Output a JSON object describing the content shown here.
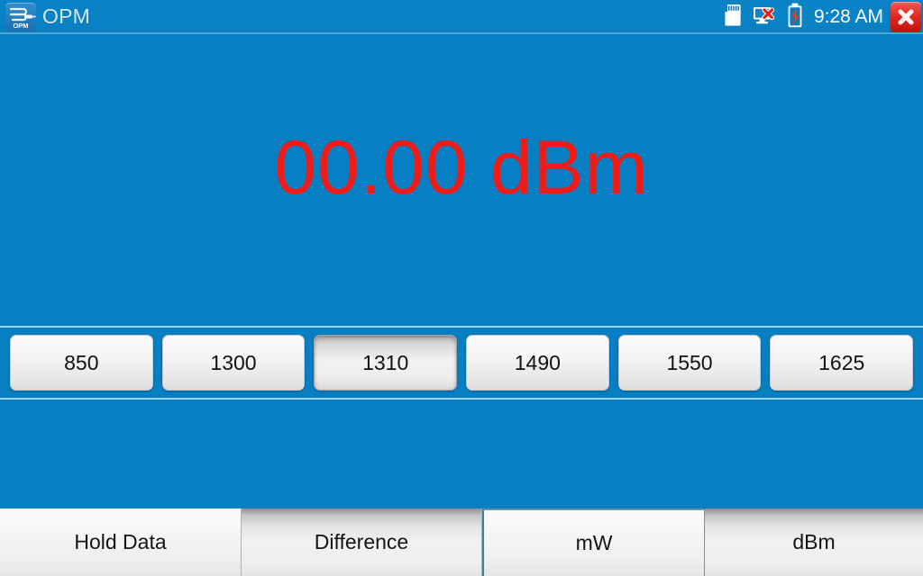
{
  "window": {
    "title": "OPM",
    "app_icon": "opm-fiber-connector-icon",
    "icon_label": "OPM",
    "background_color": "#077fc2",
    "close_button": "close-icon"
  },
  "statusbar": {
    "sd_card_icon": "sd-card-icon",
    "network_icon": "network-disconnected-icon",
    "battery_icon": "battery-charging-icon",
    "clock": "9:28 AM"
  },
  "reading": {
    "value": "00.00 dBm",
    "color": "#ee1c18"
  },
  "wavelengths": {
    "selected": "1310",
    "options": [
      {
        "label": "850",
        "selected": false
      },
      {
        "label": "1300",
        "selected": false
      },
      {
        "label": "1310",
        "selected": true
      },
      {
        "label": "1490",
        "selected": false
      },
      {
        "label": "1550",
        "selected": false
      },
      {
        "label": "1625",
        "selected": false
      }
    ]
  },
  "bottom_bar": {
    "buttons": [
      {
        "label": "Hold Data",
        "state": "normal"
      },
      {
        "label": "Difference",
        "state": "shaded"
      },
      {
        "label": "mW",
        "state": "normal"
      },
      {
        "label": "dBm",
        "state": "shaded"
      }
    ]
  }
}
